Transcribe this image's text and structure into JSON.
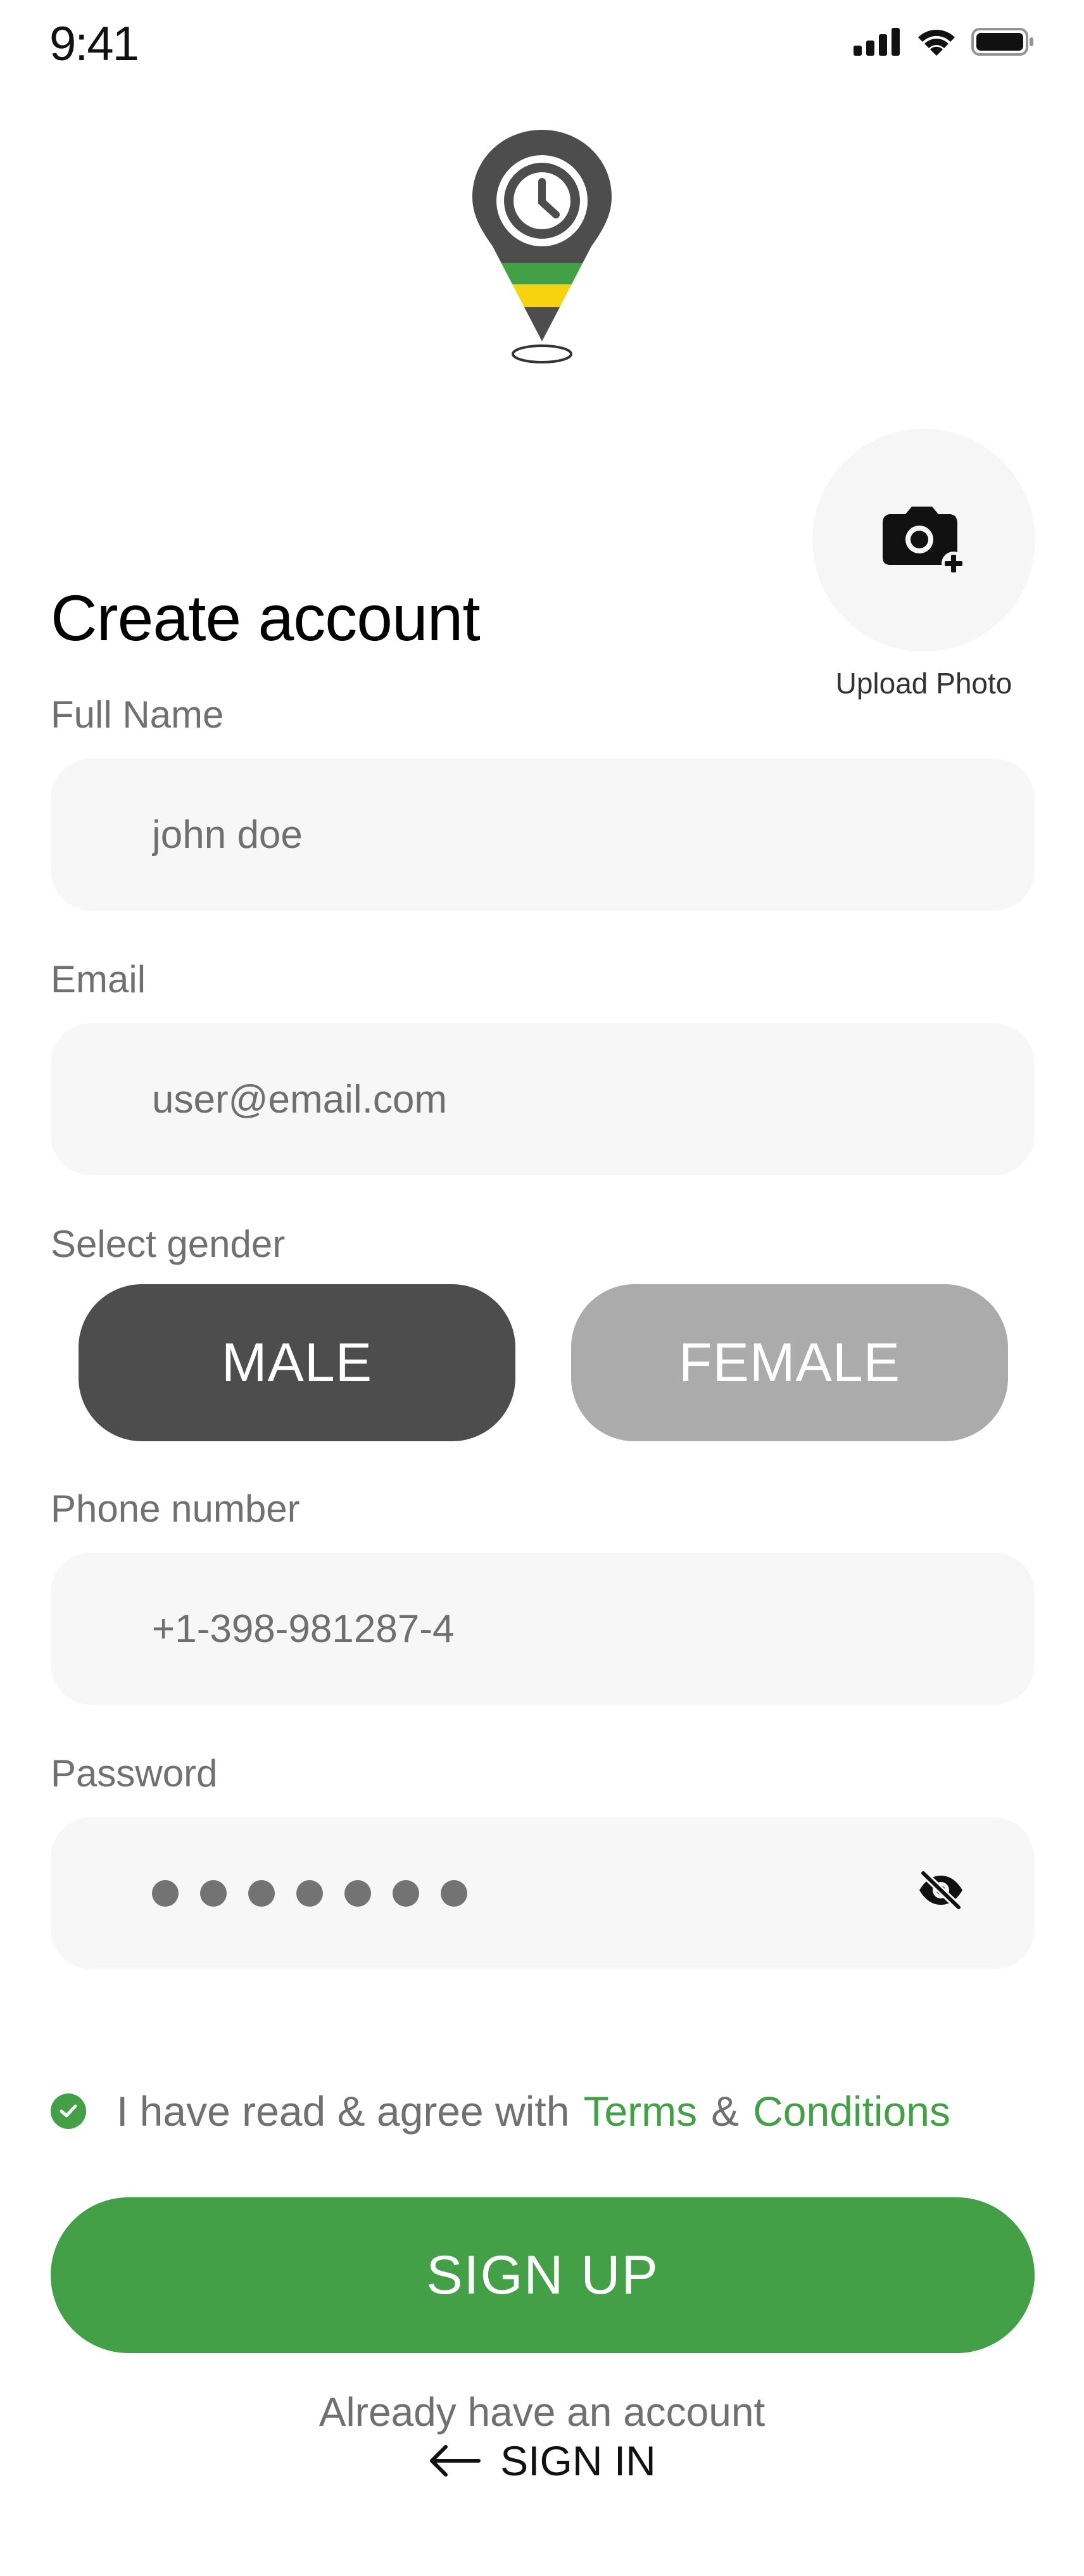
{
  "status_bar": {
    "time": "9:41"
  },
  "header": {
    "title": "Create account"
  },
  "photo": {
    "label": "Upload Photo"
  },
  "form": {
    "full_name": {
      "label": "Full Name",
      "value": "john doe"
    },
    "email": {
      "label": "Email",
      "value": "user@email.com"
    },
    "gender": {
      "label": "Select gender",
      "male": "MALE",
      "female": "FEMALE",
      "selected": "MALE"
    },
    "phone": {
      "label": "Phone number",
      "value": "+1-398-981287-4"
    },
    "password": {
      "label": "Password",
      "masked_length": 7
    }
  },
  "agree": {
    "prefix": "I have read & agree with",
    "terms": "Terms",
    "amp": "&",
    "conditions": "Conditions"
  },
  "actions": {
    "signup": "SIGN UP",
    "already": "Already have an account",
    "signin": "SIGN IN"
  },
  "colors": {
    "accent": "#43a047",
    "selected": "#4d4d4d",
    "unselected": "#ababab",
    "field_bg": "#f7f7f7",
    "yellow": "#f7d20f"
  }
}
